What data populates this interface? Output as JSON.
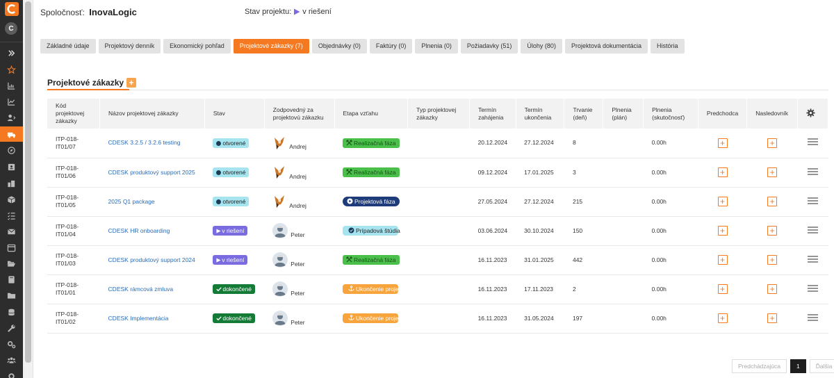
{
  "header": {
    "company_label": "Spoločnosť:",
    "company_name": "InovaLogic",
    "status_label": "Stav projektu:",
    "status_value": "v riešení",
    "status_color": "#7b6be0"
  },
  "sidebar": {
    "avatar_letter": "C",
    "brand_color": "#f47920"
  },
  "tabs": [
    {
      "label": "Základné údaje"
    },
    {
      "label": "Projektový denník"
    },
    {
      "label": "Ekonomický pohľad"
    },
    {
      "label": "Projektové zákazky (7)"
    },
    {
      "label": "Objednávky (0)"
    },
    {
      "label": "Faktúry (0)"
    },
    {
      "label": "Plnenia (0)"
    },
    {
      "label": "Požiadavky (51)"
    },
    {
      "label": "Úlohy (80)"
    },
    {
      "label": "Projektová dokumentácia"
    },
    {
      "label": "História"
    }
  ],
  "section": {
    "title": "Projektové zákazky",
    "add": "+"
  },
  "table": {
    "columns": {
      "code": "Kód projektovej zákazky",
      "name": "Názov projektovej zákazky",
      "status": "Stav",
      "responsible": "Zodpovedný za projektovú zákazku",
      "stage": "Etapa vzťahu",
      "type": "Typ projektovej zákazky",
      "start": "Termín zahájenia",
      "end": "Termín ukončenia",
      "duration": "Trvanie (deň)",
      "plan": "Plnenia (plán)",
      "actual": "Plnenia (skutočnosť)",
      "predecessor": "Predchodca",
      "successor": "Nasledovník"
    },
    "rows": [
      {
        "code": "ITP-018-IT01/07",
        "name": "CDESK 3.2.5 / 3.2.6 testing",
        "status": "otvorené",
        "status_type": "open",
        "responsible": "Andrej",
        "avatar": "fox",
        "stage": "Realizačná fáza",
        "stage_type": "real",
        "type": "",
        "start": "20.12.2024",
        "end": "27.12.2024",
        "duration": "8",
        "plan": "",
        "actual": "0.00h"
      },
      {
        "code": "ITP-018-IT01/06",
        "name": "CDESK produktový support 2025",
        "status": "otvorené",
        "status_type": "open",
        "responsible": "Andrej",
        "avatar": "fox",
        "stage": "Realizačná fáza",
        "stage_type": "real",
        "type": "",
        "start": "09.12.2024",
        "end": "17.01.2025",
        "duration": "3",
        "plan": "",
        "actual": "0.00h"
      },
      {
        "code": "ITP-018-IT01/05",
        "name": "2025 Q1 package",
        "status": "otvorené",
        "status_type": "open",
        "responsible": "Andrej",
        "avatar": "fox",
        "stage": "Projektová fáza",
        "stage_type": "proj",
        "type": "",
        "start": "27.05.2024",
        "end": "27.12.2024",
        "duration": "215",
        "plan": "",
        "actual": "0.00h"
      },
      {
        "code": "ITP-018-IT01/04",
        "name": "CDESK HR onboarding",
        "status": "v riešení",
        "status_type": "prog",
        "responsible": "Peter",
        "avatar": "person",
        "stage": "Prípadová štúdia",
        "stage_type": "case",
        "type": "",
        "start": "03.06.2024",
        "end": "30.10.2024",
        "duration": "150",
        "plan": "",
        "actual": "0.00h"
      },
      {
        "code": "ITP-018-IT01/03",
        "name": "CDESK produktový support 2024",
        "status": "v riešení",
        "status_type": "prog",
        "responsible": "Peter",
        "avatar": "person",
        "stage": "Realizačná fáza",
        "stage_type": "real",
        "type": "",
        "start": "16.11.2023",
        "end": "31.01.2025",
        "duration": "442",
        "plan": "",
        "actual": "0.00h"
      },
      {
        "code": "ITP-018-IT01/01",
        "name": "CDESK rámcová zmluva",
        "status": "dokončené",
        "status_type": "done",
        "responsible": "Peter",
        "avatar": "person",
        "stage": "Ukončenie projektu",
        "stage_type": "end",
        "type": "",
        "start": "16.11.2023",
        "end": "17.11.2023",
        "duration": "2",
        "plan": "",
        "actual": "0.00h"
      },
      {
        "code": "ITP-018-IT01/02",
        "name": "CDESK Implementácia",
        "status": "dokončené",
        "status_type": "done",
        "responsible": "Peter",
        "avatar": "person",
        "stage": "Ukončenie projektu",
        "stage_type": "end",
        "type": "",
        "start": "16.11.2023",
        "end": "31.05.2024",
        "duration": "197",
        "plan": "",
        "actual": "0.00h"
      }
    ]
  },
  "pagination": {
    "prev": "Predchádzajúca",
    "current": "1",
    "next": "Ďalšia"
  }
}
